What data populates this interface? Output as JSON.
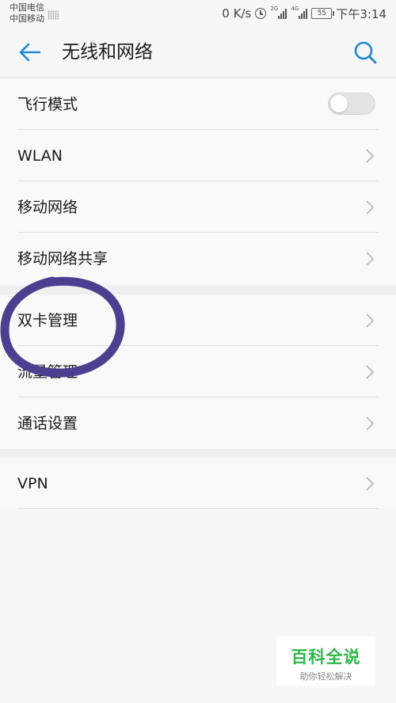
{
  "status_bar": {
    "carrier_1": "中国电信",
    "carrier_2": "中国移动",
    "network_speed": "0 K/s",
    "sim1_network": "2G",
    "sim2_network": "4G",
    "battery_level": "55",
    "time": "下午3:14"
  },
  "header": {
    "title": "无线和网络",
    "back_icon": "arrow-left-icon",
    "search_icon": "search-icon",
    "accent_color": "#1e88d4"
  },
  "sections": [
    {
      "items": [
        {
          "label": "飞行模式",
          "control": "toggle",
          "checked": false
        },
        {
          "label": "WLAN",
          "control": "chevron"
        },
        {
          "label": "移动网络",
          "control": "chevron"
        },
        {
          "label": "移动网络共享",
          "control": "chevron"
        }
      ]
    },
    {
      "items": [
        {
          "label": "双卡管理",
          "control": "chevron"
        },
        {
          "label": "流量管理",
          "control": "chevron"
        },
        {
          "label": "通话设置",
          "control": "chevron"
        }
      ]
    },
    {
      "items": [
        {
          "label": "VPN",
          "control": "chevron"
        }
      ]
    }
  ],
  "annotation": {
    "shape": "hand-drawn-circle",
    "color": "#4b3f8f",
    "target": "双卡管理"
  },
  "watermark": {
    "brand": "百科全说",
    "slogan": "助你轻松解决",
    "color": "#2db84a"
  }
}
